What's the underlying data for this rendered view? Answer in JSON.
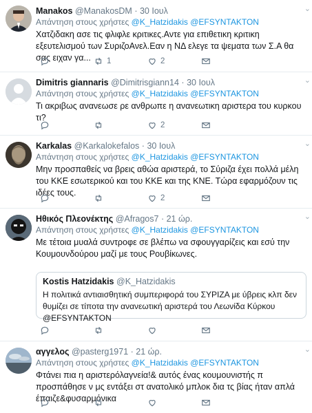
{
  "reply_prefix": "Απάντηση στους χρήστες",
  "tweets": [
    {
      "name": "Manakos",
      "handle": "@ManakosDM",
      "time": "30 Ιουλ",
      "mentions": [
        "@K_Hatzidakis",
        "@EFSYNTAKTON"
      ],
      "text": "Χατζιδακη ασε τις φλιφλε κριτικες.Αντε για επιθετικη κριτικη εξευτελισμού των ΣυριζοΑνελ.Εαν η ΝΔ ελεγε τα ψεματα των Σ.Α θα σας ειχαν γα...",
      "replies": "",
      "retweets": "1",
      "likes": "2",
      "avatar_icon": "profile-photo-man-suit"
    },
    {
      "name": "Dimitris giannaris",
      "handle": "@Dimitrisgiann14",
      "time": "30 Ιουλ",
      "mentions": [
        "@K_Hatzidakis",
        "@EFSYNTAKTON"
      ],
      "text": "Τι ακριβως ανανεωσε ρε ανθρωπε η ανανεωτικη αριστερα του κυρκου τι?",
      "replies": "",
      "retweets": "",
      "likes": "2",
      "avatar_icon": "default-egg-avatar"
    },
    {
      "name": "Karkalas",
      "handle": "@Karkalokefalos",
      "time": "30 Ιουλ",
      "mentions": [
        "@K_Hatzidakis",
        "@EFSYNTAKTON"
      ],
      "text": "Μην προσπαθείς να βρεις αθώα αριστερά, το Σύριζα έχει πολλά μέλη του ΚΚΕ εσωτερικού και του ΚΚΕ και της ΚΝΕ. Τώρα εφαρμόζουν τις ιδέες τους.",
      "replies": "",
      "retweets": "",
      "likes": "2",
      "avatar_icon": "ancient-statue-head"
    },
    {
      "name": "Ηθικός Πλεονέκτης",
      "handle": "@Afragos7",
      "time": "21 ώρ.",
      "mentions": [
        "@K_Hatzidakis",
        "@EFSYNTAKTON"
      ],
      "text": "Με τέτοια μυαλά συντροφε σε βλέπω να σφουγγαρίζεις και εσύ την Κουμουνδούρου μαζί με τους Ρουβίκωνες.",
      "replies": "",
      "retweets": "",
      "likes": "",
      "avatar_icon": "masked-figure",
      "quote": {
        "name": "Kostis Hatzidakis",
        "handle": "@K_Hatzidakis",
        "text": "Η πολιτικά αντιαισθητική συμπεριφορά του ΣΥΡΙΖΑ  με ύβρεις κλπ δεν θυμίζει σε τίποτα την ανανεωτική αριστερά του Λεωνίδα Κύρκου @EFSYNTAKTON"
      }
    },
    {
      "name": "αγγελος",
      "handle": "@pasterg1971",
      "time": "21 ώρ.",
      "mentions": [
        "@K_Hatzidakis",
        "@EFSYNTAKTON"
      ],
      "text": "Φτάνει πια η αριστερόλαγνεία!& αυτός ένας κουμουνιστής π προσπάθησε ν μς εντάξει στ ανατολικό μπλοκ δια τς βίας ήταν απλά έπαιζε&φυσαρμόνικα",
      "replies": "",
      "retweets": "",
      "likes": "",
      "avatar_icon": "sky-landscape-photo"
    }
  ]
}
